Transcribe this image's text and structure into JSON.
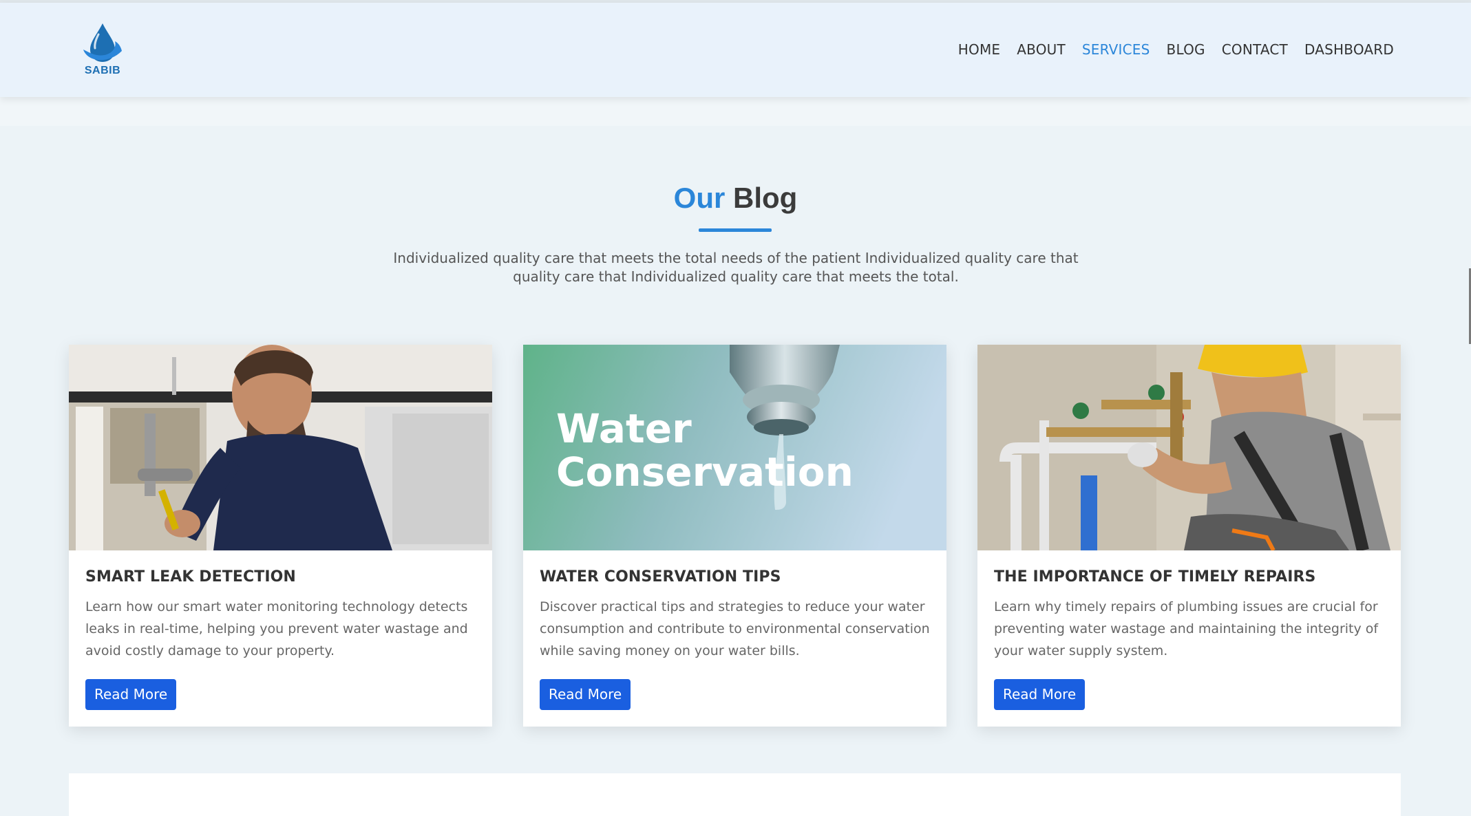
{
  "brand": {
    "name": "SABIB"
  },
  "nav": {
    "items": [
      {
        "label": "HOME",
        "active": false
      },
      {
        "label": "ABOUT",
        "active": false
      },
      {
        "label": "SERVICES",
        "active": true
      },
      {
        "label": "BLOG",
        "active": false
      },
      {
        "label": "CONTACT",
        "active": false
      },
      {
        "label": "DASHBOARD",
        "active": false
      }
    ]
  },
  "blog": {
    "title_accent": "Our",
    "title_rest": "Blog",
    "description": "Individualized quality care that meets the total needs of the patient Individualized quality care that quality care that Individualized quality care that meets the total.",
    "cards": [
      {
        "image": "plumber-under-sink-photo",
        "title": "SMART LEAK DETECTION",
        "text": "Learn how our smart water monitoring technology detects leaks in real-time, helping you prevent water wastage and avoid costly damage to your property.",
        "button": "Read More"
      },
      {
        "image": "water-conservation-faucet-photo",
        "image_text_line1": "Water",
        "image_text_line2": "Conservation",
        "title": "WATER CONSERVATION TIPS",
        "text": "Discover practical tips and strategies to reduce your water consumption and contribute to environmental conservation while saving money on your water bills.",
        "button": "Read More"
      },
      {
        "image": "worker-repairing-pipes-photo",
        "title": "THE IMPORTANCE OF TIMELY REPAIRS",
        "text": "Learn why timely repairs of plumbing issues are crucial for preventing water wastage and maintaining the integrity of your water supply system.",
        "button": "Read More"
      }
    ]
  },
  "colors": {
    "accent": "#2b86d9",
    "button": "#1a5fe0",
    "header_bg": "#e9f2fb",
    "page_bg": "#ecf3f7"
  }
}
